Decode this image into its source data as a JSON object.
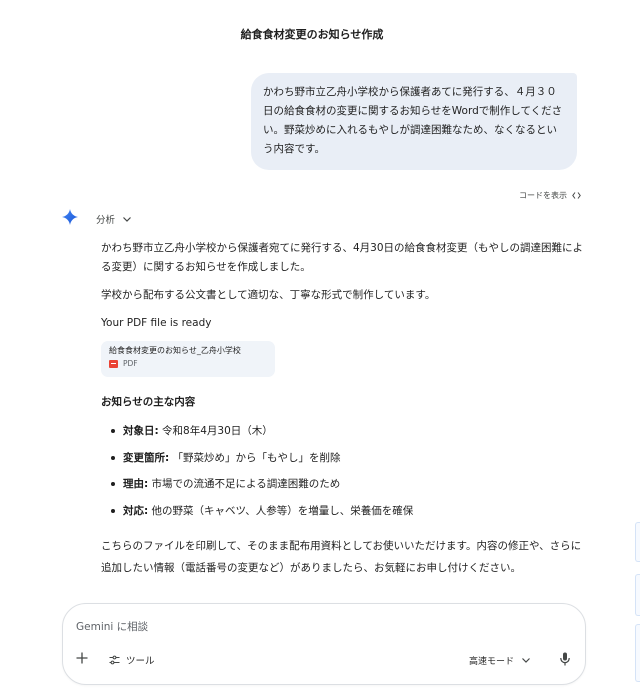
{
  "page": {
    "title": "給食食材変更のお知らせ作成"
  },
  "user_message": "かわち野市立乙舟小学校から保護者あてに発行する、４月３０日の給食食材の変更に関するお知らせをWordで制作してください。野菜炒めに入れるもやしが調達困難なため、なくなるという内容です。",
  "show_code": {
    "label": "コードを表示"
  },
  "analysis": {
    "label": "分析"
  },
  "response": {
    "intro": "かわち野市立乙舟小学校から保護者宛てに発行する、4月30日の給食食材変更（もやしの調達困難による変更）に関するお知らせを作成しました。",
    "formal": "学校から配布する公文書として適切な、丁寧な形式で制作しています。",
    "ready": "Your PDF file is ready",
    "file": {
      "name": "給食食材変更のお知らせ_乙舟小学校",
      "type": "PDF"
    },
    "heading": "お知らせの主な内容",
    "points": [
      {
        "label": "対象日:",
        "text": " 令和8年4月30日（木）"
      },
      {
        "label": "変更箇所:",
        "text": " 「野菜炒め」から「もやし」を削除"
      },
      {
        "label": "理由:",
        "text": " 市場での流通不足による調達困難のため"
      },
      {
        "label": "対応:",
        "text": " 他の野菜（キャベツ、人参等）を増量し、栄養価を確保"
      }
    ],
    "closing": "こちらのファイルを印刷して、そのまま配布用資料としてお使いいただけます。内容の修正や、さらに追加したい情報（電話番号の変更など）がありましたら、お気軽にお申し付けください。"
  },
  "input": {
    "placeholder": "Gemini に相談",
    "tools_label": "ツール",
    "mode_label": "高速モード"
  },
  "colors": {
    "accent": "#1a73e8",
    "bubble": "#e9eef6",
    "pdf": "#ea4335"
  }
}
